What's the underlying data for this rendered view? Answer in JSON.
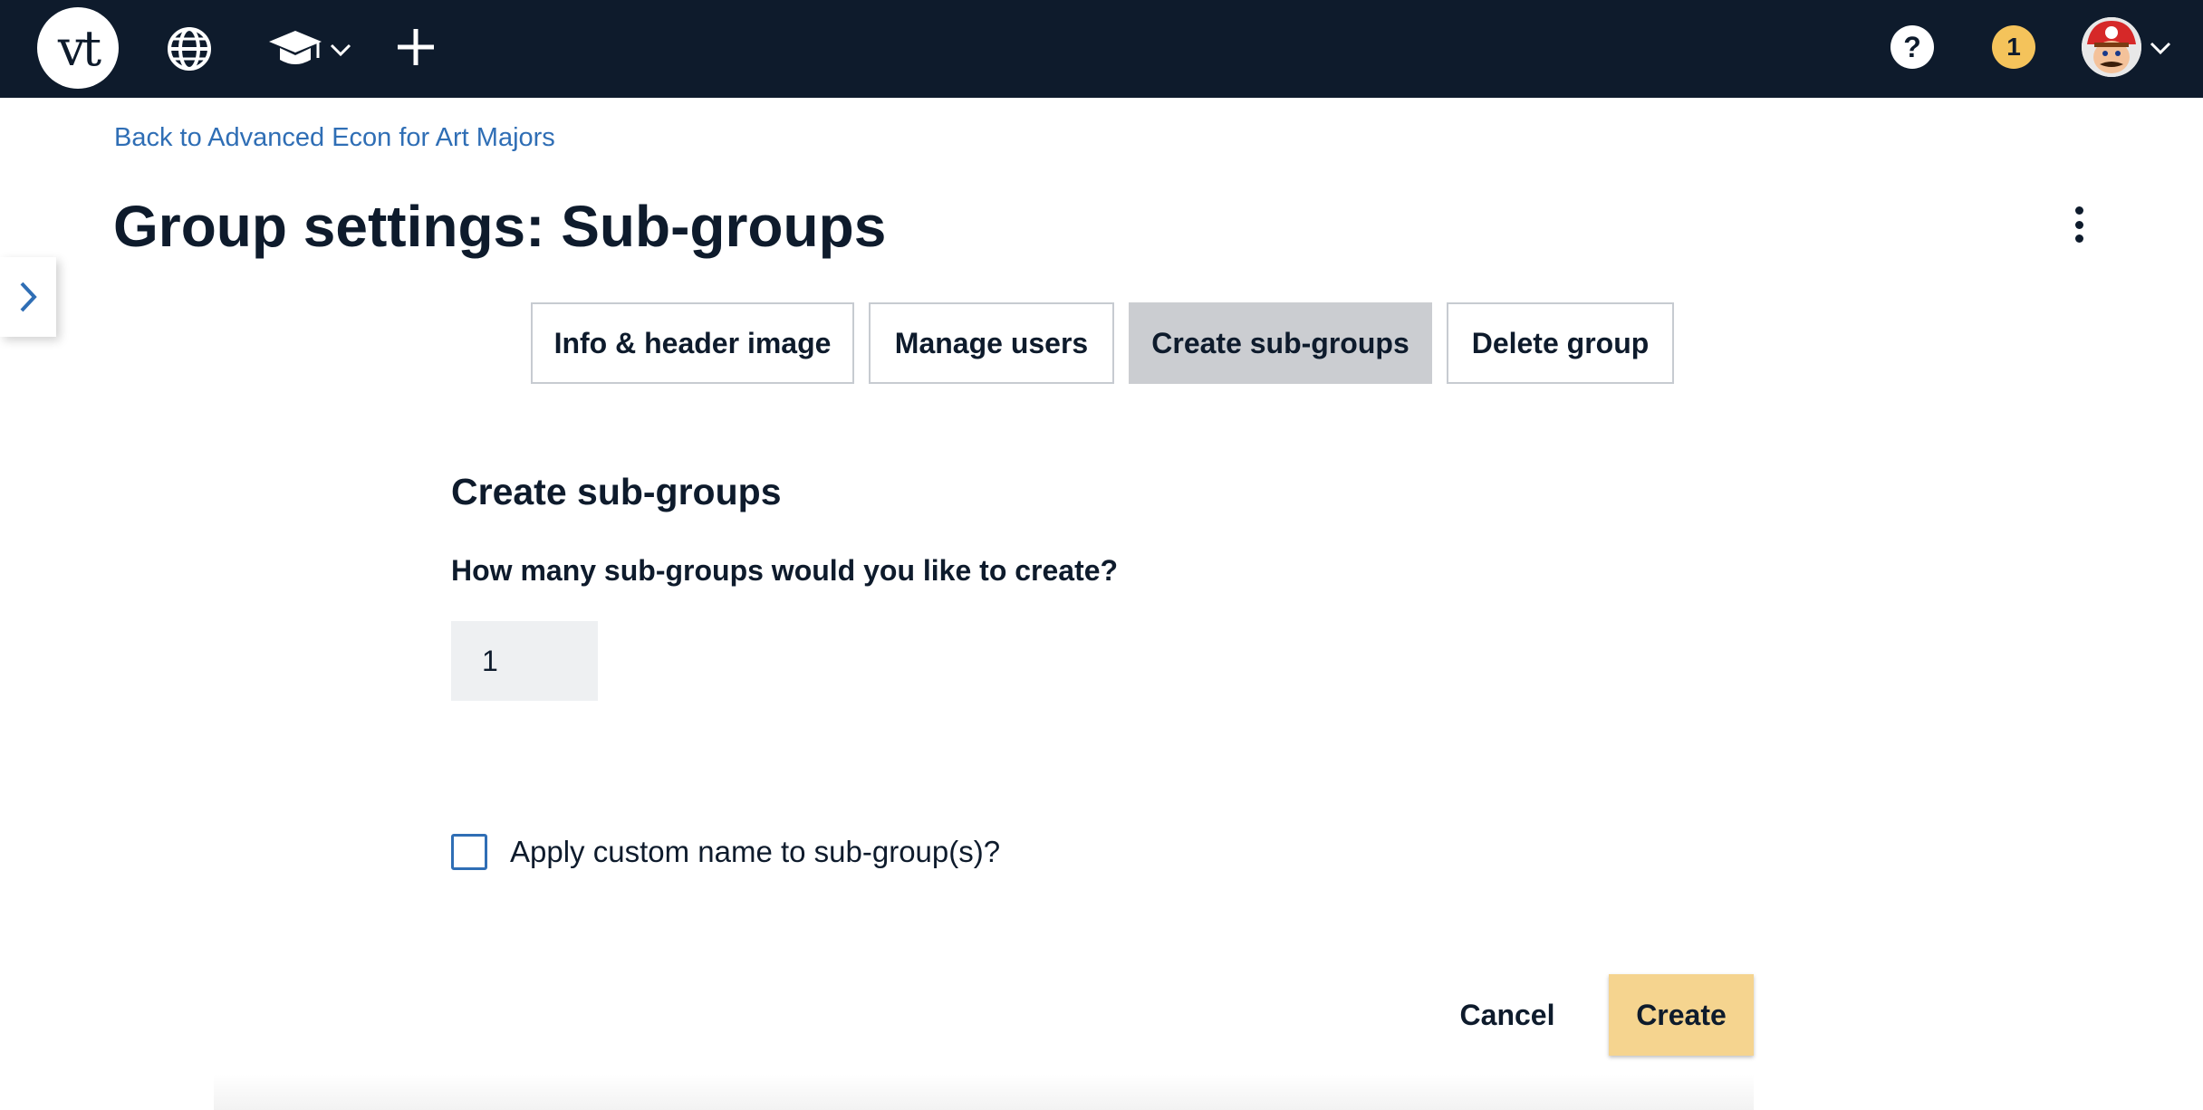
{
  "nav": {
    "logo_text": "vt",
    "icons": [
      "globe-icon",
      "graduation-cap-icon",
      "chevron-down-icon",
      "plus-icon",
      "help-icon",
      "avatar",
      "chevron-down-icon"
    ],
    "help_label": "?",
    "notification_count": "1"
  },
  "page": {
    "back_link": "Back to Advanced Econ for Art Majors",
    "title": "Group settings: Sub-groups"
  },
  "tabs": [
    {
      "label": "Info & header image",
      "active": false
    },
    {
      "label": "Manage users",
      "active": false
    },
    {
      "label": "Create sub-groups",
      "active": true
    },
    {
      "label": "Delete group",
      "active": false
    }
  ],
  "form": {
    "section_title": "Create sub-groups",
    "question": "How many sub-groups would you like to create?",
    "quantity_value": "1",
    "checkbox_label": "Apply custom name to sub-group(s)?",
    "checkbox_checked": false
  },
  "actions": {
    "cancel_label": "Cancel",
    "create_label": "Create"
  },
  "colors": {
    "nav_bg": "#0e1b2c",
    "link": "#2f6eb5",
    "badge": "#f4c35b",
    "create_button": "#f5d48f",
    "active_tab": "#cbcdd1"
  }
}
